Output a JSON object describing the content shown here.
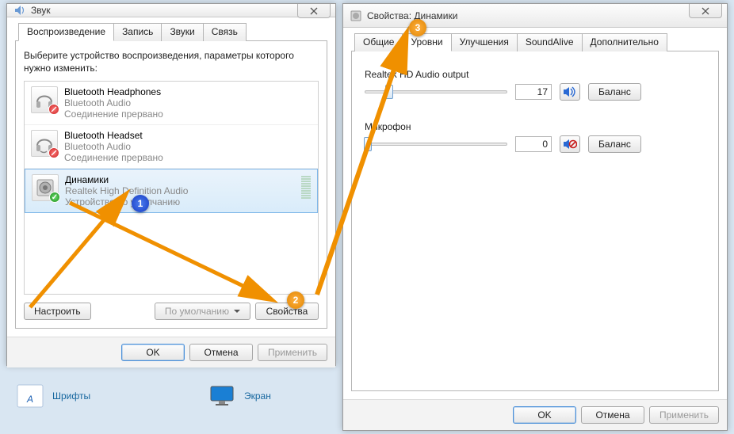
{
  "sound_window": {
    "title": "Звук",
    "tabs": [
      "Воспроизведение",
      "Запись",
      "Звуки",
      "Связь"
    ],
    "active_tab": 0,
    "instruction": "Выберите устройство воспроизведения, параметры которого нужно изменить:",
    "devices": [
      {
        "name": "Bluetooth Headphones",
        "sub": "Bluetooth Audio",
        "status": "Соединение прервано",
        "icon": "headphones",
        "badge": "err"
      },
      {
        "name": "Bluetooth Headset",
        "sub": "Bluetooth Audio",
        "status": "Соединение прервано",
        "icon": "headset",
        "badge": "err"
      },
      {
        "name": "Динамики",
        "sub": "Realtek High Definition Audio",
        "status": "Устройство по умолчанию",
        "icon": "speaker",
        "badge": "ok",
        "selected": true
      }
    ],
    "buttons": {
      "configure": "Настроить",
      "set_default": "По умолчанию",
      "properties": "Свойства"
    },
    "dialog": {
      "ok": "OK",
      "cancel": "Отмена",
      "apply": "Применить"
    }
  },
  "props_window": {
    "title": "Свойства: Динамики",
    "tabs": [
      "Общие",
      "Уровни",
      "Улучшения",
      "SoundAlive",
      "Дополнительно"
    ],
    "active_tab": 1,
    "levels": [
      {
        "label": "Realtek HD Audio output",
        "value": "17",
        "muted": false,
        "slider_pct": 17,
        "balance": "Баланс"
      },
      {
        "label": "Микрофон",
        "value": "0",
        "muted": true,
        "slider_pct": 0,
        "balance": "Баланс"
      }
    ],
    "dialog": {
      "ok": "OK",
      "cancel": "Отмена",
      "apply": "Применить"
    }
  },
  "markers": {
    "m1": "1",
    "m2": "2",
    "m3": "3"
  },
  "desktop": {
    "fonts": "Шрифты",
    "screen": "Экран"
  }
}
